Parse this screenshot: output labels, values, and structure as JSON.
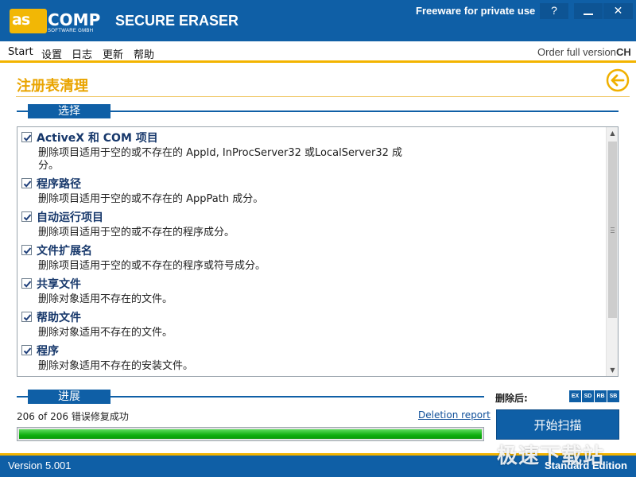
{
  "titlebar": {
    "logo_left": "as",
    "logo_right": "COMP",
    "logo_sub": "SOFTWARE GMBH",
    "app_title": "SECURE ERASER",
    "freeware": "Freeware for private use",
    "help_btn": "?",
    "close_btn": "✕"
  },
  "menu": {
    "items": [
      "Start",
      "设置",
      "日志",
      "更新",
      "帮助"
    ],
    "order_link": "Order full version",
    "language": "CH"
  },
  "page": {
    "title": "注册表清理",
    "select_section": "选择",
    "progress_section": "进展"
  },
  "options": [
    {
      "label": "ActiveX 和 COM 项目",
      "description": "删除项目适用于空的或不存在的 AppId, InProcServer32 或LocalServer32 成分。",
      "checked": true
    },
    {
      "label": "程序路径",
      "description": "删除项目适用于空的或不存在的 AppPath 成分。",
      "checked": true
    },
    {
      "label": "自动运行项目",
      "description": "删除项目适用于空的或不存在的程序成分。",
      "checked": true
    },
    {
      "label": "文件扩展名",
      "description": "删除项目适用于空的或不存在的程序或符号成分。",
      "checked": true
    },
    {
      "label": "共享文件",
      "description": "删除对象适用不存在的文件。",
      "checked": true
    },
    {
      "label": "帮助文件",
      "description": "删除对象适用不存在的文件。",
      "checked": true
    },
    {
      "label": "程序",
      "description": "删除对象适用不存在的安装文件。",
      "checked": true
    }
  ],
  "progress": {
    "status": "206 of 206 错误修复成功",
    "deletion_report": "Deletion report",
    "fraction": 1.0
  },
  "after_delete": {
    "label": "删除后:",
    "buttons": [
      "EX",
      "SD",
      "RB",
      "SB"
    ]
  },
  "scan_button": "开始扫描",
  "status": {
    "version": "Version 5.001",
    "edition": "Standard Edition"
  },
  "watermark": "极速下载站",
  "colors": {
    "brand_blue": "#0f5fa6",
    "accent_yellow": "#f3b400",
    "progress_green": "#10b010"
  }
}
